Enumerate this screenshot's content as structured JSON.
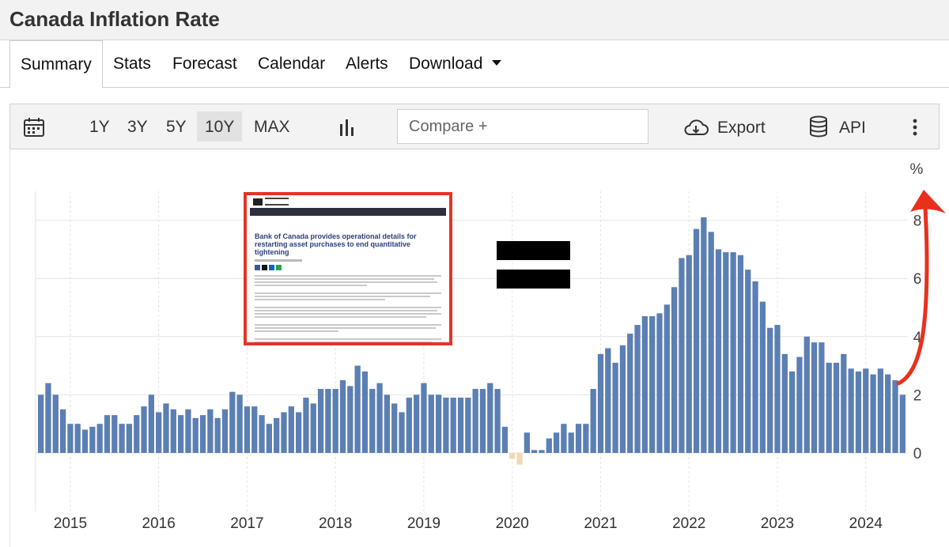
{
  "page": {
    "title": "Canada Inflation Rate"
  },
  "tabs": [
    "Summary",
    "Stats",
    "Forecast",
    "Calendar",
    "Alerts",
    "Download"
  ],
  "toolbar": {
    "ranges": [
      "1Y",
      "3Y",
      "5Y",
      "10Y",
      "MAX"
    ],
    "selected_range": "10Y",
    "compare_placeholder": "Compare +",
    "export_label": "Export",
    "api_label": "API",
    "icons": [
      "calendar-icon",
      "bar-chart-icon",
      "cloud-download-icon",
      "database-icon",
      "more-vertical-icon"
    ]
  },
  "news_clipping": {
    "headline": "Bank of Canada provides operational details for restarting asset purchases to end quantitative tightening",
    "border_color": "#e53424"
  },
  "chart_data": {
    "type": "bar",
    "y_unit_label": "%",
    "ylim": [
      -1.8,
      9
    ],
    "yticks": [
      0,
      2,
      4,
      6,
      8
    ],
    "x_tick_labels": [
      "2015",
      "2016",
      "2017",
      "2018",
      "2019",
      "2020",
      "2021",
      "2022",
      "2023",
      "2024"
    ],
    "x_start": "2014-09",
    "x_end": "2024-08",
    "grid": true,
    "bar_color": "#5b7fb3",
    "negative_bar_color": "#f0d9b5",
    "values": [
      2.0,
      2.4,
      2.0,
      1.5,
      1.0,
      1.0,
      0.8,
      0.9,
      1.0,
      1.3,
      1.3,
      1.0,
      1.0,
      1.3,
      1.6,
      2.0,
      1.4,
      1.7,
      1.5,
      1.3,
      1.5,
      1.2,
      1.3,
      1.5,
      1.2,
      1.5,
      2.1,
      2.0,
      1.6,
      1.6,
      1.3,
      1.0,
      1.2,
      1.4,
      1.6,
      1.4,
      1.9,
      1.7,
      2.2,
      2.2,
      2.2,
      2.5,
      2.3,
      3.0,
      2.8,
      2.2,
      2.4,
      2.0,
      1.7,
      1.4,
      1.9,
      2.0,
      2.4,
      2.0,
      2.0,
      1.9,
      1.9,
      1.9,
      1.9,
      2.2,
      2.2,
      2.4,
      2.2,
      0.9,
      -0.2,
      -0.4,
      0.7,
      0.1,
      0.1,
      0.5,
      0.7,
      1.0,
      0.7,
      1.0,
      1.0,
      2.2,
      3.4,
      3.6,
      3.1,
      3.7,
      4.1,
      4.4,
      4.7,
      4.7,
      4.8,
      5.1,
      5.7,
      6.7,
      6.8,
      7.7,
      8.1,
      7.6,
      7.0,
      6.9,
      6.9,
      6.8,
      6.3,
      5.9,
      5.2,
      4.3,
      4.4,
      3.4,
      2.8,
      3.3,
      4.0,
      3.8,
      3.8,
      3.1,
      3.1,
      3.4,
      2.9,
      2.8,
      2.9,
      2.7,
      2.9,
      2.7,
      2.5,
      2.0
    ]
  }
}
